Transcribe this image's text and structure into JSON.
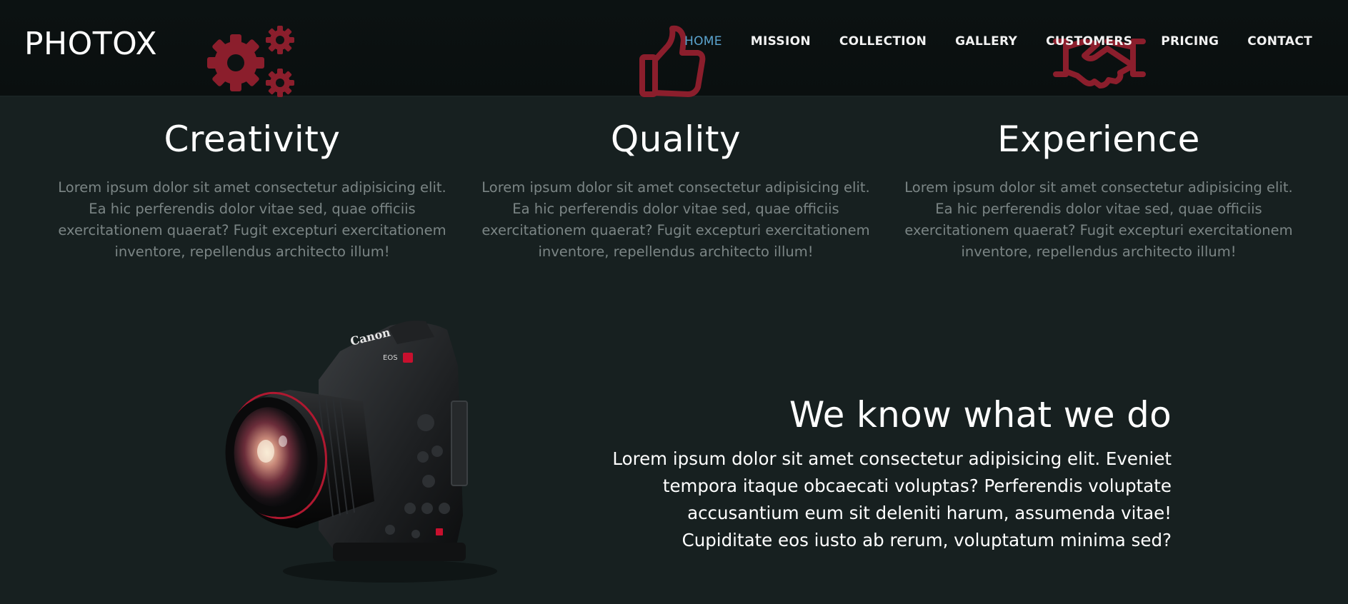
{
  "header": {
    "brand": "PHOTOX",
    "nav": [
      {
        "label": "HOME",
        "active": true
      },
      {
        "label": "MISSION",
        "active": false
      },
      {
        "label": "COLLECTION",
        "active": false
      },
      {
        "label": "GALLERY",
        "active": false
      },
      {
        "label": "CUSTOMERS",
        "active": false
      },
      {
        "label": "PRICING",
        "active": false
      },
      {
        "label": "CONTACT",
        "active": false
      }
    ]
  },
  "features": [
    {
      "icon": "gears-icon",
      "title": "Creativity",
      "text": "Lorem ipsum dolor sit amet consectetur adipisicing elit. Ea hic perferendis dolor vitae sed, quae officiis exercitationem quaerat? Fugit excepturi exercitationem inventore, repellendus architecto illum!"
    },
    {
      "icon": "thumbs-up-icon",
      "title": "Quality",
      "text": "Lorem ipsum dolor sit amet consectetur adipisicing elit. Ea hic perferendis dolor vitae sed, quae officiis exercitationem quaerat? Fugit excepturi exercitationem inventore, repellendus architecto illum!"
    },
    {
      "icon": "handshake-icon",
      "title": "Experience",
      "text": "Lorem ipsum dolor sit amet consectetur adipisicing elit. Ea hic perferendis dolor vitae sed, quae officiis exercitationem quaerat? Fugit excepturi exercitationem inventore, repellendus architecto illum!"
    }
  ],
  "about": {
    "title": "We know what we do",
    "text": "Lorem ipsum dolor sit amet consectetur adipisicing elit. Eveniet tempora itaque obcaecati voluptas? Perferendis voluptate accusantium eum sit deleniti harum, assumenda vitae! Cupiditate eos iusto ab rerum, voluptatum minima sed?",
    "camera_brand": "Canon",
    "camera_model": "EOS"
  },
  "colors": {
    "background": "#172020",
    "navbar": "#0b1111",
    "accent": "#5ba4cf",
    "icon": "#8b1e2c",
    "muted_text": "#7b8585"
  }
}
